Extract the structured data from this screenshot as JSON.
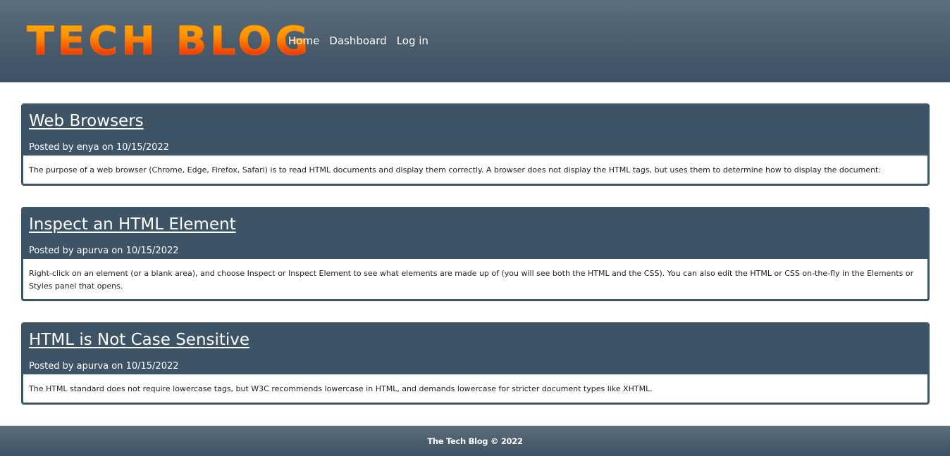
{
  "header": {
    "logo_text": "TECH BLOG",
    "nav": [
      {
        "label": "Home"
      },
      {
        "label": "Dashboard"
      },
      {
        "label": "Log in"
      }
    ]
  },
  "posts": [
    {
      "title": "Web Browsers",
      "meta": "Posted by enya on 10/15/2022",
      "body": "The purpose of a web browser (Chrome, Edge, Firefox, Safari) is to read HTML documents and display them correctly. A browser does not display the HTML tags, but uses them to determine how to display the document:"
    },
    {
      "title": "Inspect an HTML Element",
      "meta": "Posted by apurva on 10/15/2022",
      "body": "Right-click on an element (or a blank area), and choose Inspect or Inspect Element to see what elements are made up of (you will see both the HTML and the CSS). You can also edit the HTML or CSS on-the-fly in the Elements or Styles panel that opens."
    },
    {
      "title": "HTML is Not Case Sensitive",
      "meta": "Posted by apurva on 10/15/2022",
      "body": "The HTML standard does not require lowercase tags, but W3C recommends lowercase in HTML, and demands lowercase for stricter document types like XHTML."
    }
  ],
  "footer": {
    "text": "The Tech Blog © 2022"
  },
  "colors": {
    "header_bg": "#4a5c6c",
    "card_header_bg": "#3d5366",
    "logo_gradient_top": "#ffb300",
    "logo_gradient_bottom": "#d81c00"
  }
}
